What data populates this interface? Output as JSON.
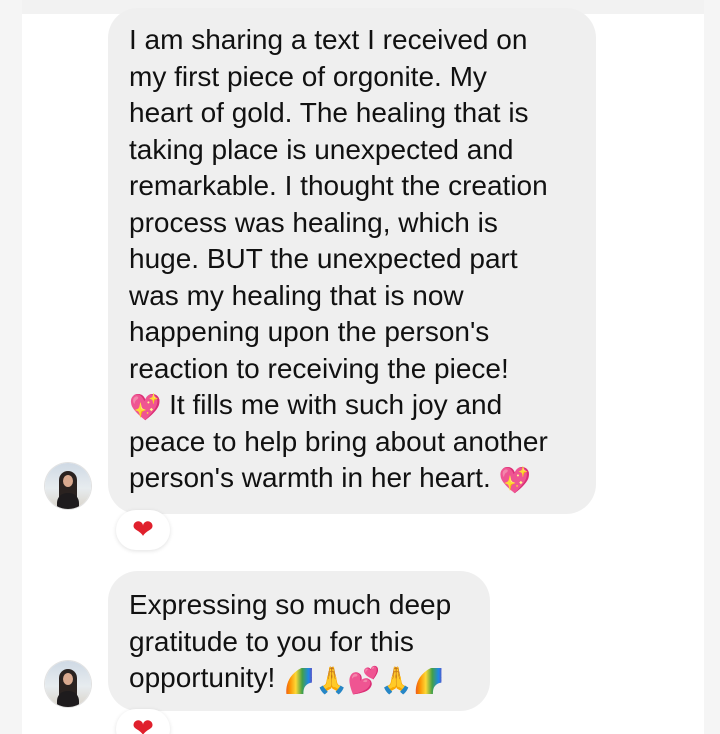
{
  "messages": [
    {
      "id": "msg-1",
      "text_before_emoji": "I am sharing a text I received on\nmy first piece of orgonite. My\nheart of gold. The healing that is\ntaking place is unexpected and\nremarkable. I thought the creation\nprocess was healing, which is\nhuge. BUT the unexpected part\nwas my healing that is now\nhappening upon the person's\nreaction to receiving the piece!\n",
      "emoji_1": "💖",
      "text_middle": " It fills me with such joy and\npeace to help bring about another\nperson's warmth in her heart. ",
      "emoji_2": "💖",
      "reaction": "❤"
    },
    {
      "id": "msg-2",
      "text": "Expressing so much deep\ngratitude to you for this\nopportunity! ",
      "emojis": [
        "🌈",
        "🙏",
        "💕",
        "🙏",
        "🌈"
      ],
      "reaction": "❤"
    }
  ],
  "colors": {
    "bubble_background": "#efefef",
    "text": "#111111",
    "reaction_heart": "#e0202c",
    "page_background": "#ffffff"
  },
  "icons": {
    "avatar": "user-avatar-photo",
    "reaction": "red-heart-icon",
    "sparkle_heart": "sparkling-heart-icon"
  }
}
